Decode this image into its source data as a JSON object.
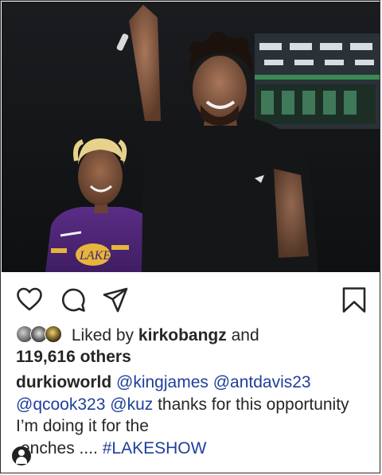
{
  "post": {
    "photo": {
      "jersey_team": "LAKERS"
    },
    "actions": {
      "like_icon": "heart-icon",
      "comment_icon": "comment-icon",
      "share_icon": "paper-plane-icon",
      "save_icon": "bookmark-icon"
    },
    "likes": {
      "prefix": "Liked by",
      "user": "kirkobangz",
      "conjunction": "and",
      "count": "119,616 others"
    },
    "caption": {
      "author": "durkioworld",
      "mention_1": "@kingjames",
      "mention_2": "@antdavis23",
      "mention_3": "@qcook323",
      "mention_4": "@kuz",
      "text_1": "thanks for this opportunity I’m doing it for the",
      "text_2": "enches ....",
      "hashtag": "#LAKESHOW"
    }
  }
}
